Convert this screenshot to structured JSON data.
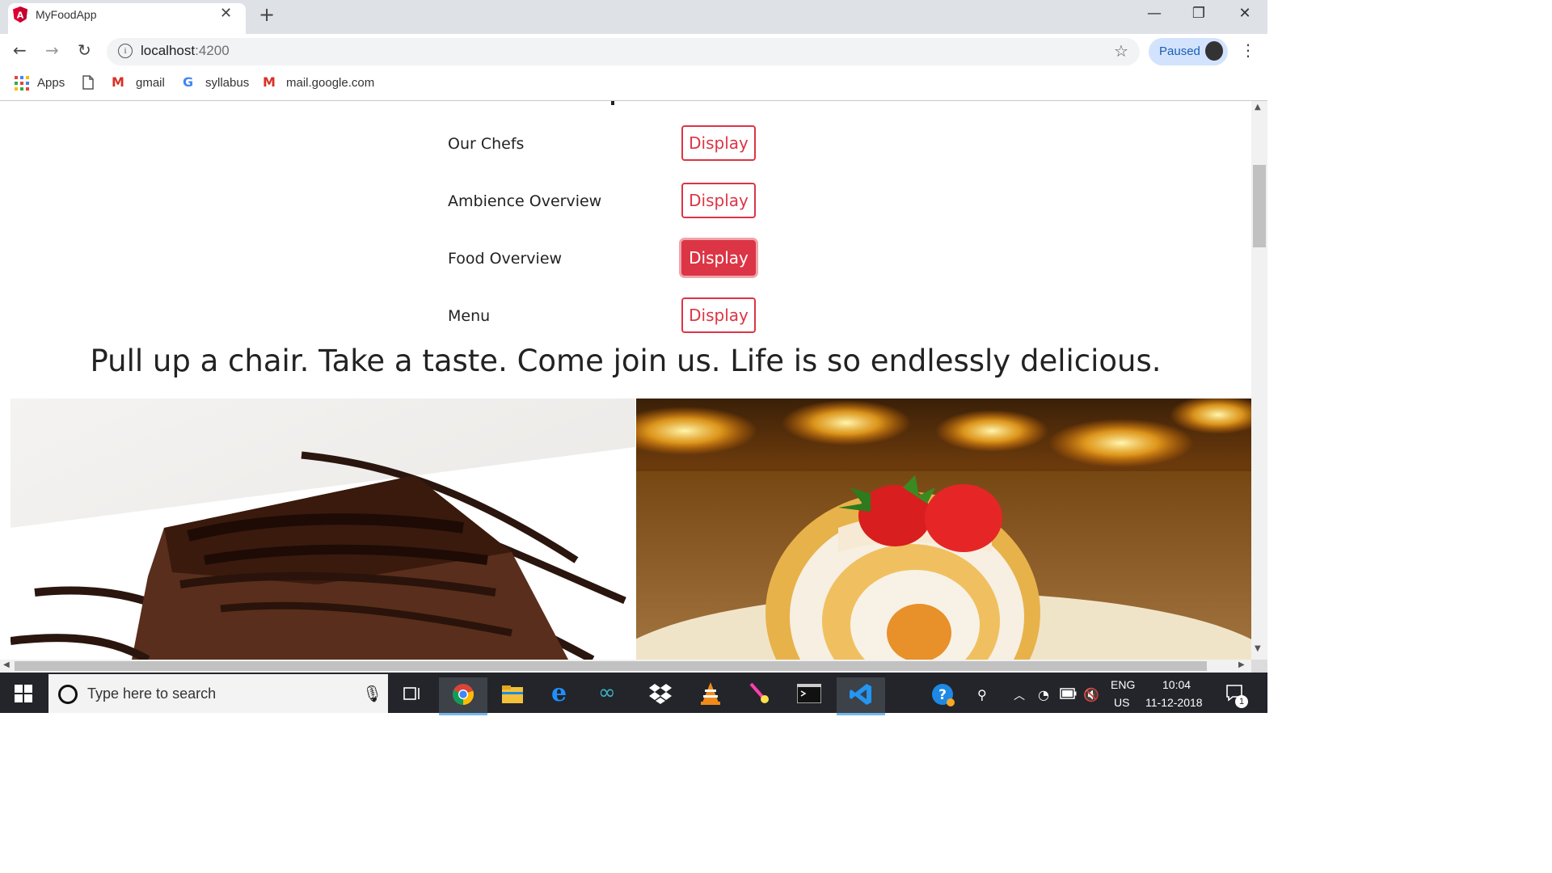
{
  "browser": {
    "tab_title": "MyFoodApp",
    "url_host": "localhost",
    "url_port": ":4200",
    "profile_status": "Paused",
    "bookmarks": [
      {
        "label": "Apps",
        "icon": "apps-grid-icon"
      },
      {
        "label": "",
        "icon": "page-icon"
      },
      {
        "label": "gmail",
        "icon": "gmail-icon"
      },
      {
        "label": "syllabus",
        "icon": "google-icon"
      },
      {
        "label": "mail.google.com",
        "icon": "gmail-icon"
      }
    ]
  },
  "page": {
    "sections": [
      {
        "label": "Our Chefs",
        "button": "Display",
        "active": false
      },
      {
        "label": "Ambience Overview",
        "button": "Display",
        "active": false
      },
      {
        "label": "Food Overview",
        "button": "Display",
        "active": true
      },
      {
        "label": "Menu",
        "button": "Display",
        "active": false
      }
    ],
    "tagline": "Pull up a chair. Take a taste. Come join us. Life is so endlessly delicious.",
    "images": [
      "chocolate-cake-image",
      "strawberry-roll-cake-image"
    ]
  },
  "colors": {
    "accent": "#dc3545",
    "taskbar": "#23252a"
  },
  "taskbar": {
    "search_placeholder": "Type here to search",
    "lang_line1": "ENG",
    "lang_line2": "US",
    "time": "10:04",
    "date": "11-12-2018",
    "notification_count": "1"
  }
}
